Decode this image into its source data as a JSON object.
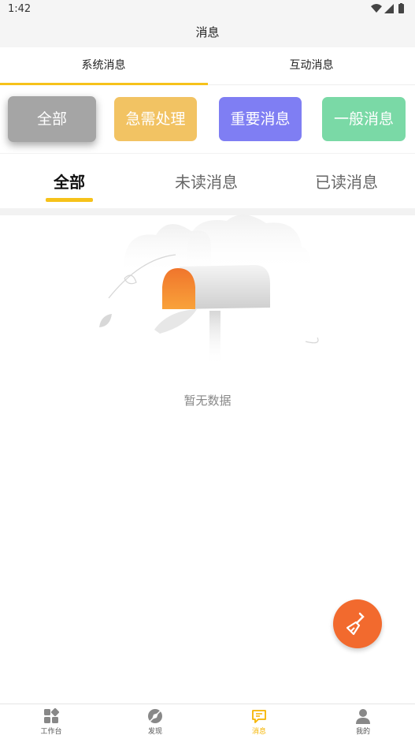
{
  "status_bar": {
    "time": "1:42"
  },
  "header": {
    "title": "消息"
  },
  "top_tabs": [
    {
      "label": "系统消息",
      "active": true
    },
    {
      "label": "互动消息",
      "active": false
    }
  ],
  "categories": [
    {
      "label": "全部",
      "color": "#a5a5a5",
      "selected": true
    },
    {
      "label": "急需处理",
      "color": "#f2c363"
    },
    {
      "label": "重要消息",
      "color": "#7f7ef3"
    },
    {
      "label": "一般消息",
      "color": "#7ad9a6"
    }
  ],
  "read_tabs": [
    {
      "label": "全部",
      "active": true
    },
    {
      "label": "未读消息"
    },
    {
      "label": "已读消息"
    }
  ],
  "empty_state": {
    "text": "暂无数据",
    "icon": "mailbox-illustration"
  },
  "fab": {
    "icon": "broom-icon",
    "color": "#f26a2e"
  },
  "bottom_nav": [
    {
      "label": "工作台",
      "icon": "grid-icon"
    },
    {
      "label": "发现",
      "icon": "compass-icon"
    },
    {
      "label": "消息",
      "icon": "message-icon",
      "active": true
    },
    {
      "label": "我的",
      "icon": "user-icon"
    }
  ],
  "colors": {
    "accent": "#f6c21a",
    "nav_active": "#f5b400"
  }
}
